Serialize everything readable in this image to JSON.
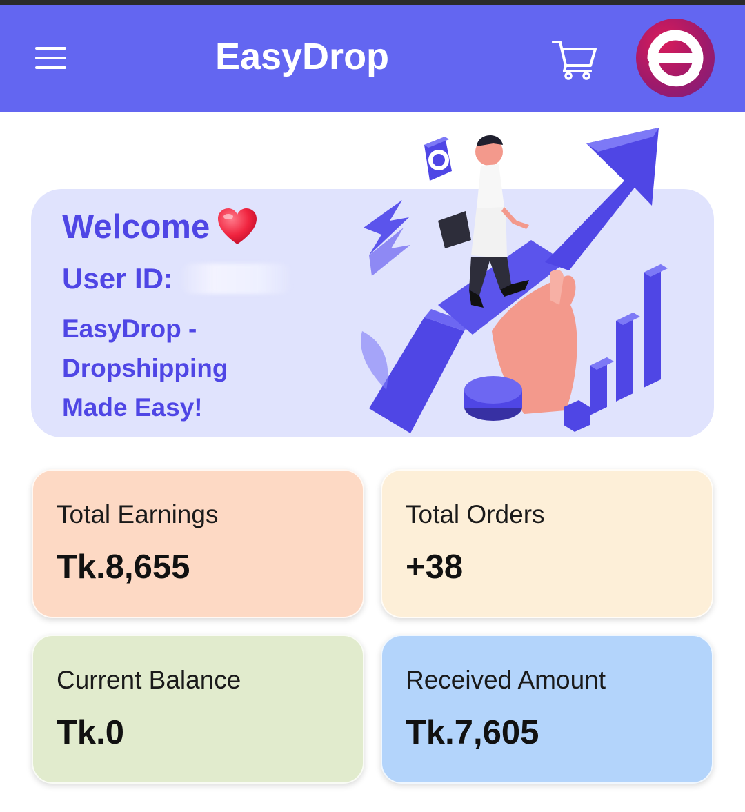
{
  "header": {
    "title": "EasyDrop",
    "menu_icon": "hamburger-menu-icon",
    "cart_icon": "shopping-cart-icon",
    "avatar_icon": "easydrop-logo-icon"
  },
  "welcome": {
    "greeting": "Welcome",
    "heart_icon": "heart-emoji-icon",
    "user_id_label": "User ID:",
    "user_id_value": "",
    "tagline": "EasyDrop - Dropshipping Made Easy!"
  },
  "stats": [
    {
      "label": "Total Earnings",
      "value": "Tk.8,655",
      "color": "#fdd9c4"
    },
    {
      "label": "Total Orders",
      "value": "+38",
      "color": "#fdefd8"
    },
    {
      "label": "Current Balance",
      "value": "Tk.0",
      "color": "#e1ebcd"
    },
    {
      "label": "Received Amount",
      "value": "Tk.7,605",
      "color": "#b3d4fb"
    }
  ],
  "colors": {
    "primary": "#6366f1",
    "accent_text": "#4f46e5",
    "welcome_bg": "#e0e3fd"
  }
}
